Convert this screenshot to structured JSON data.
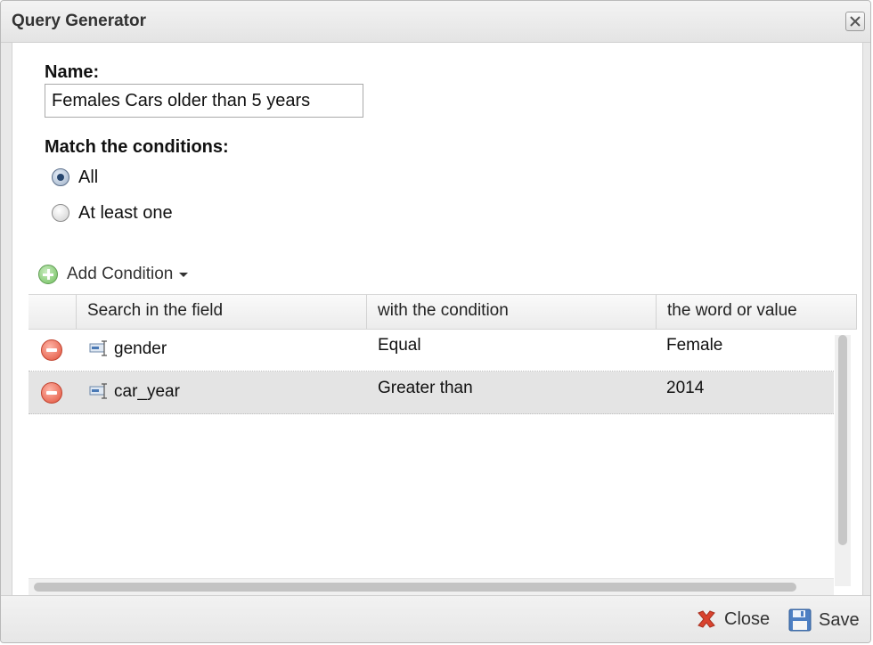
{
  "window": {
    "title": "Query Generator"
  },
  "form": {
    "name_label": "Name:",
    "name_value": "Females Cars older than 5 years",
    "match_label": "Match the conditions:",
    "match_options": [
      {
        "label": "All",
        "checked": true
      },
      {
        "label": "At least one",
        "checked": false
      }
    ]
  },
  "toolbar": {
    "add_condition_label": "Add Condition"
  },
  "grid": {
    "columns": [
      "Search in the field",
      "with the condition",
      "the word or value"
    ],
    "rows": [
      {
        "field": "gender",
        "condition": "Equal",
        "value": "Female",
        "selected": false
      },
      {
        "field": "car_year",
        "condition": "Greater than",
        "value": "2014",
        "selected": true
      }
    ]
  },
  "footer": {
    "close_label": "Close",
    "save_label": "Save"
  },
  "icons": {
    "window_close": "close-x-icon",
    "add": "plus-circle-icon",
    "remove": "minus-circle-icon",
    "field": "text-field-icon",
    "close": "red-x-icon",
    "save": "floppy-disk-icon"
  }
}
